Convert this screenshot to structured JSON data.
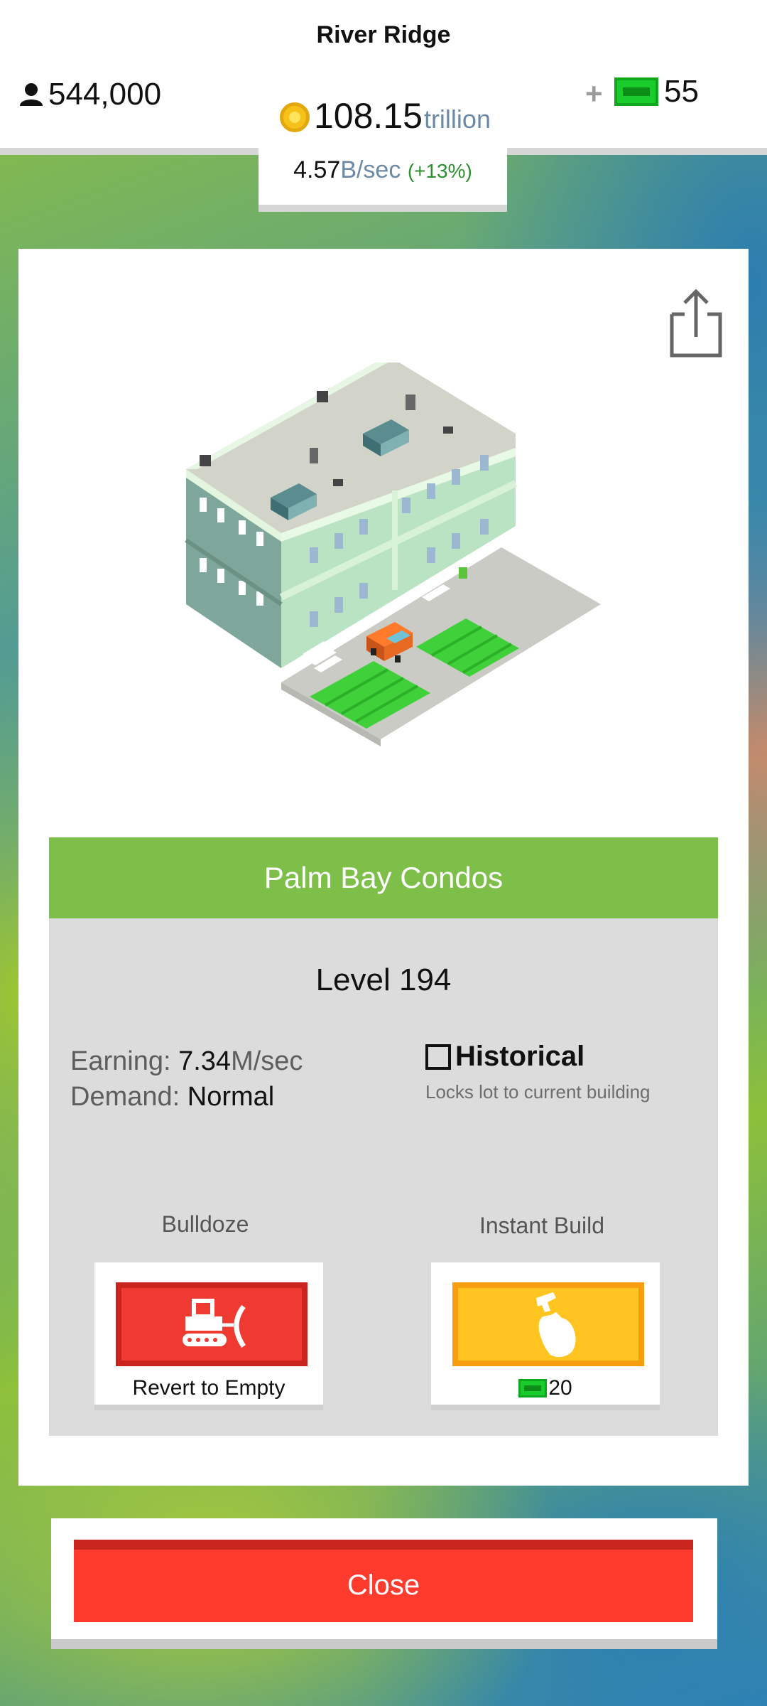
{
  "header": {
    "city_name": "River Ridge",
    "population": "544,000",
    "cash": "55",
    "plus_icon": "+",
    "coins_value": "108.15",
    "coins_unit": "trillion",
    "rate_value": "4.57",
    "rate_unit": "B/sec",
    "rate_change": "(+13%)"
  },
  "building": {
    "name": "Palm Bay Condos",
    "level": "Level 194",
    "earning_label": "Earning:",
    "earning_value": "7.34",
    "earning_unit": "M/sec",
    "demand_label": "Demand:",
    "demand_value": "Normal"
  },
  "historical": {
    "label": "Historical",
    "subtitle": "Locks lot to current building",
    "checked": false
  },
  "actions": {
    "bulldoze_caption": "Bulldoze",
    "bulldoze_label": "Revert to Empty",
    "instant_caption": "Instant Build",
    "instant_cost": "20"
  },
  "close_label": "Close",
  "icons": {
    "population": "person-icon",
    "cash": "cash-bill-icon",
    "coins": "coin-icon",
    "share": "share-icon",
    "bulldoze": "bulldozer-icon",
    "instant_build": "hammer-hand-icon"
  },
  "colors": {
    "banner": "#7dbf48",
    "bulldoze": "#ee3a31",
    "instant_build": "#ffc41f",
    "close": "#ff3b2e",
    "cash": "#19cc2b",
    "coin": "#f6c21a"
  }
}
